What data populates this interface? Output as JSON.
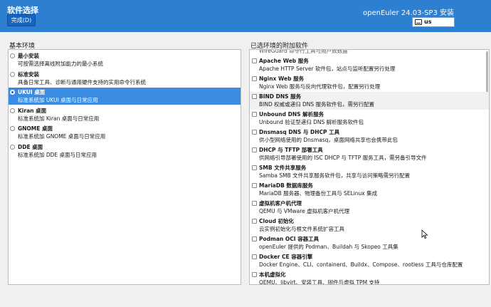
{
  "header": {
    "title": "软件选择",
    "done_label": "完成(D)",
    "product": "openEuler 24.03-SP3 安装",
    "keyboard_layout": "us"
  },
  "left": {
    "title": "基本环境",
    "items": [
      {
        "name": "最小安装",
        "desc": "可按需选择离线附加能力的最小系统",
        "selected": false
      },
      {
        "name": "标准安装",
        "desc": "具备日常工具、诊断与通用硬件支持的实用命令行系统",
        "selected": false
      },
      {
        "name": "UKUI 桌面",
        "desc": "标准系统加 UKUI 桌面与日常应用",
        "selected": true
      },
      {
        "name": "Kiran 桌面",
        "desc": "标准系统加 Kiran 桌面与日常应用",
        "selected": false
      },
      {
        "name": "GNOME 桌面",
        "desc": "标准系统加 GNOME 桌面与日常应用",
        "selected": false
      },
      {
        "name": "DDE 桌面",
        "desc": "标准系统加 DDE 桌面与日常应用",
        "selected": false
      }
    ]
  },
  "right": {
    "title": "已选环境的附加软件",
    "clipped_text": "WireGuard 命令行工具与用户数数据",
    "items": [
      {
        "name": "Apache Web 服务",
        "desc": "Apache HTTP Server 软件包，站点与监听配置另行处理"
      },
      {
        "name": "Nginx Web 服务",
        "desc": "Nginx Web 服务与反向代理软件包，配置另行处理"
      },
      {
        "name": "BIND DNS 服务",
        "desc": "BIND 权威或递归 DNS 服务软件包，需另行配置"
      },
      {
        "name": "Unbound DNS 解析服务",
        "desc": "Unbound 验证型递归 DNS 解析服务软件包"
      },
      {
        "name": "Dnsmasq DNS 与 DHCP 工具",
        "desc": "供小型网络使用的 Dnsmasq，桌面网络共享也会携带此包"
      },
      {
        "name": "DHCP 与 TFTP 部署工具",
        "desc": "供网络引导部署使用的 ISC DHCP 与 TFTP 服务工具，需另备引导文件"
      },
      {
        "name": "SMB 文件共享服务",
        "desc": "Samba SMB 文件共享服务软件包，共享与访问策略需另行配置"
      },
      {
        "name": "MariaDB 数据库服务",
        "desc": "MariaDB 服务器、物理备份工具与 SELinux 集成"
      },
      {
        "name": "虚拟机客户机代理",
        "desc": "QEMU 与 VMware 虚拟机客户机代理"
      },
      {
        "name": "Cloud 初始化",
        "desc": "云实例初始化与根文件系统扩容工具"
      },
      {
        "name": "Podman OCI 容器工具",
        "desc": "openEuler 提供的 Podman、Buildah 与 Skopeo 工具集"
      },
      {
        "name": "Docker CE 容器引擎",
        "desc": "Docker Engine、CLI、containerd、Buildx、Compose、rootless 工具与仓库配置"
      },
      {
        "name": "本机虚拟化",
        "desc": "QEMU、libvirt、安装工具、固件与虚拟 TPM 支持"
      }
    ]
  }
}
